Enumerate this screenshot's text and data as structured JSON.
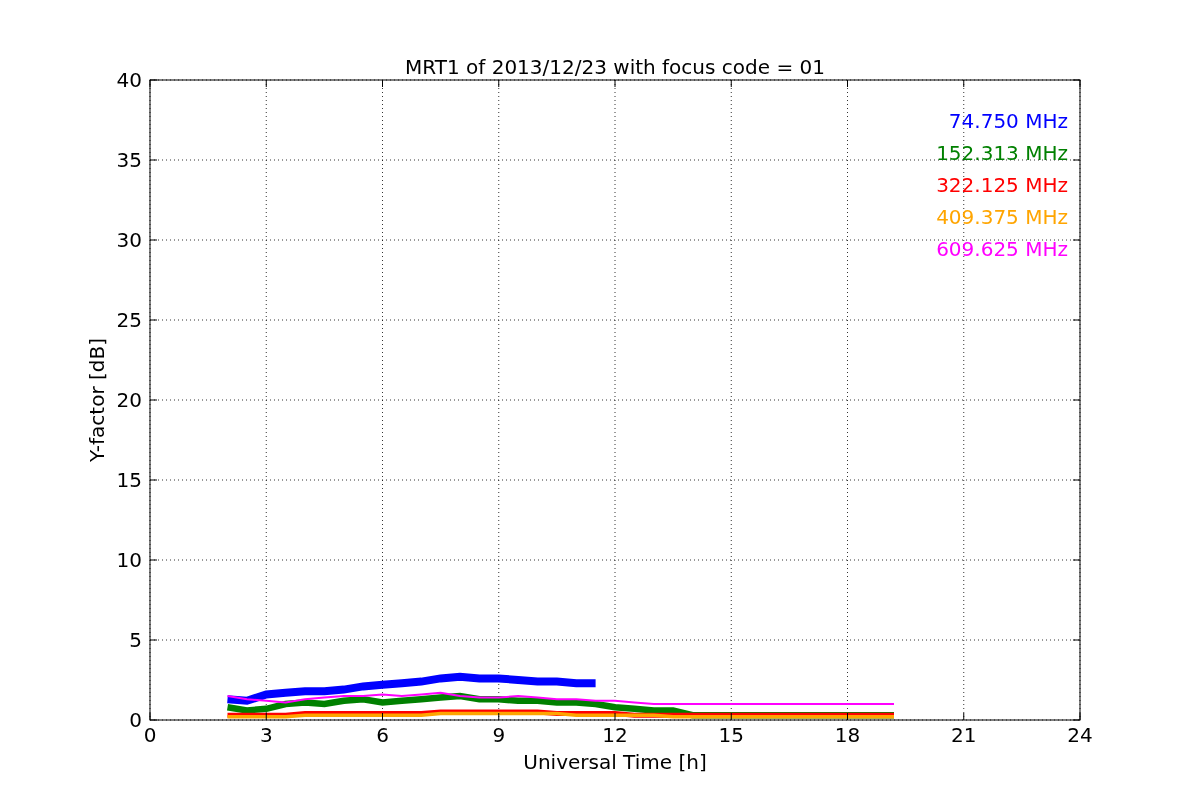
{
  "figure": {
    "chart_data": {
      "type": "line",
      "title": "MRT1 of 2013/12/23 with focus code = 01",
      "xlabel": "Universal Time [h]",
      "ylabel": "Y-factor [dB]",
      "grid": true,
      "xlim": [
        0,
        24
      ],
      "ylim": [
        0,
        40
      ],
      "xticks": [
        0,
        3,
        6,
        9,
        12,
        15,
        18,
        21,
        24
      ],
      "yticks": [
        0,
        5,
        10,
        15,
        20,
        25,
        30,
        35,
        40
      ],
      "x": [
        2,
        2.5,
        3,
        3.5,
        4,
        4.5,
        5,
        5.5,
        6,
        6.5,
        7,
        7.5,
        8,
        8.5,
        9,
        9.5,
        10,
        10.5,
        11,
        11.5,
        12,
        12.5,
        13,
        13.5,
        14,
        19.2
      ],
      "series": [
        {
          "name": "74.750 MHz",
          "color": "#0000ff",
          "values": [
            1.3,
            1.2,
            1.6,
            1.7,
            1.8,
            1.8,
            1.9,
            2.1,
            2.2,
            2.3,
            2.4,
            2.6,
            2.7,
            2.6,
            2.6,
            2.5,
            2.4,
            2.4,
            2.3,
            2.3,
            null,
            null,
            null,
            null,
            null,
            null
          ]
        },
        {
          "name": "152.313 MHz",
          "color": "#008000",
          "values": [
            0.8,
            0.6,
            0.7,
            1.0,
            1.1,
            1.0,
            1.2,
            1.3,
            1.1,
            1.2,
            1.3,
            1.4,
            1.5,
            1.3,
            1.3,
            1.2,
            1.2,
            1.1,
            1.1,
            1.0,
            0.8,
            0.7,
            0.6,
            0.6,
            0.3,
            0.3
          ]
        },
        {
          "name": "322.125 MHz",
          "color": "#ff0000",
          "values": [
            0.3,
            0.3,
            0.3,
            0.3,
            0.4,
            0.4,
            0.4,
            0.4,
            0.4,
            0.4,
            0.4,
            0.5,
            0.5,
            0.5,
            0.5,
            0.5,
            0.5,
            0.4,
            0.4,
            0.4,
            0.4,
            0.3,
            0.3,
            0.3,
            0.3,
            0.3
          ]
        },
        {
          "name": "409.375 MHz",
          "color": "#ffa500",
          "values": [
            0.2,
            0.2,
            0.2,
            0.2,
            0.3,
            0.3,
            0.3,
            0.3,
            0.3,
            0.3,
            0.3,
            0.4,
            0.4,
            0.4,
            0.4,
            0.4,
            0.4,
            0.4,
            0.3,
            0.3,
            0.3,
            0.3,
            0.3,
            0.2,
            0.2,
            0.2
          ]
        },
        {
          "name": "609.625 MHz",
          "color": "#ff00ff",
          "values": [
            1.5,
            1.3,
            1.2,
            1.1,
            1.3,
            1.4,
            1.5,
            1.5,
            1.6,
            1.5,
            1.6,
            1.7,
            1.5,
            1.4,
            1.4,
            1.5,
            1.4,
            1.3,
            1.3,
            1.2,
            1.2,
            1.1,
            1.0,
            1.0,
            1.0,
            1.0
          ]
        }
      ]
    }
  }
}
